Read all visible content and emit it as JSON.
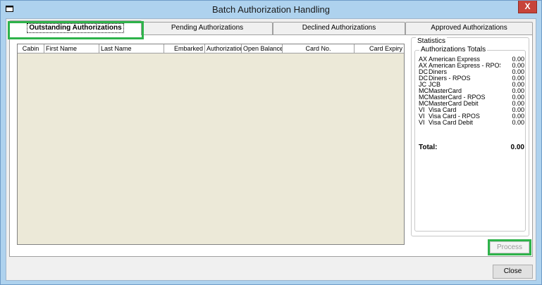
{
  "window": {
    "title": "Batch Authorization Handling",
    "close_glyph": "X"
  },
  "tabs": [
    {
      "label": "Outstanding Authorizations",
      "active": true
    },
    {
      "label": "Pending Authorizations",
      "active": false
    },
    {
      "label": "Declined Authorizations",
      "active": false
    },
    {
      "label": "Approved Authorizations",
      "active": false
    }
  ],
  "grid": {
    "columns": [
      "Cabin",
      "First Name",
      "Last Name",
      "Embarked",
      "Authorization",
      "Open Balance",
      "Card No.",
      "Card Expiry"
    ]
  },
  "statistics": {
    "title": "Statistics",
    "group_title": "Authorizations Totals",
    "rows": [
      {
        "code": "AX",
        "name": "American Express",
        "value": "0.00"
      },
      {
        "code": "AX",
        "name": "American Express - RPOS",
        "value": "0.00"
      },
      {
        "code": "DC",
        "name": "Diners",
        "value": "0.00"
      },
      {
        "code": "DC",
        "name": "Diners - RPOS",
        "value": "0.00"
      },
      {
        "code": "JC",
        "name": "JCB",
        "value": "0.00"
      },
      {
        "code": "MC",
        "name": "MasterCard",
        "value": "0.00"
      },
      {
        "code": "MC",
        "name": "MasterCard - RPOS",
        "value": "0.00"
      },
      {
        "code": "MC",
        "name": "MasterCard Debit",
        "value": "0.00"
      },
      {
        "code": "VI",
        "name": "Visa Card",
        "value": "0.00"
      },
      {
        "code": "VI",
        "name": "Visa Card - RPOS",
        "value": "0.00"
      },
      {
        "code": "VI",
        "name": "Visa Card Debit",
        "value": "0.00"
      }
    ],
    "total_label": "Total:",
    "total_value": "0.00"
  },
  "buttons": {
    "process": "Process",
    "close": "Close"
  },
  "colors": {
    "highlight": "#2eb34a",
    "grid_bg": "#ece9d8",
    "frame": "#aed2ee"
  }
}
